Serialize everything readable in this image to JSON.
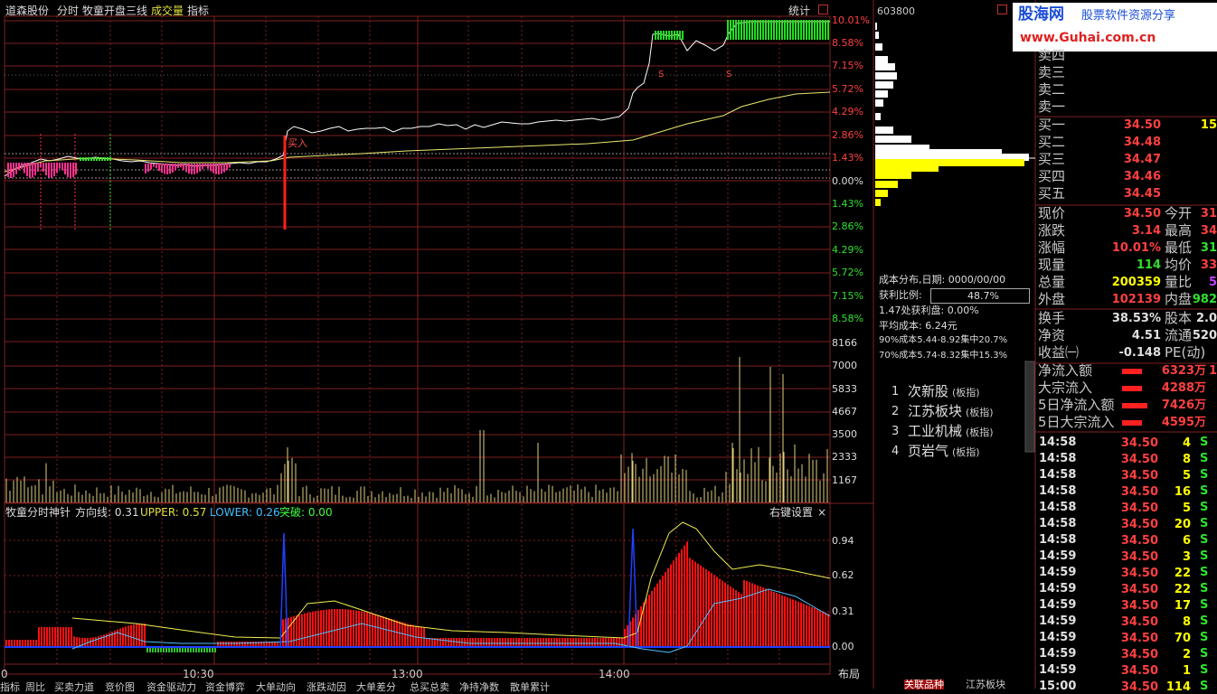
{
  "header": {
    "stock_name": "道森股份",
    "mode": "分时",
    "indicator_name": "牧童开盘三线",
    "volume_label": "成交量",
    "index_label": "指标",
    "stats_label": "统计"
  },
  "price_axis": {
    "right_labels_up": [
      "10.01%",
      "8.58%",
      "7.15%",
      "5.72%",
      "4.29%",
      "2.86%",
      "1.43%",
      "0.00%"
    ],
    "right_labels_down": [
      "1.43%",
      "2.86%",
      "4.29%",
      "5.72%",
      "7.15%",
      "8.58%"
    ],
    "volume_labels": [
      "8166",
      "7000",
      "5833",
      "4667",
      "3500",
      "2333",
      "1167"
    ],
    "indicator_labels": [
      "0.94",
      "0.62",
      "0.31",
      "0.00"
    ]
  },
  "time_axis": [
    "0",
    "10:30",
    "13:00",
    "14:00"
  ],
  "buy_marker": "买入",
  "indicator_bar": {
    "name": "牧童分时神针",
    "dir_label": "方向线: 0.31",
    "upper_label": "UPPER: 0.57",
    "lower_label": "LOWER: 0.26",
    "breakout_label": "突破: 0.00",
    "settings": "右键设置",
    "close": "×"
  },
  "bottom_tabs": [
    "指标",
    "周比",
    "买卖力道",
    "竞价图",
    "资金驱动力",
    "资金博弈",
    "大单动向",
    "涨跌动因",
    "大单差分",
    "总买总卖",
    "净持净数",
    "散单累计"
  ],
  "layout_label": "布局",
  "chip": {
    "code": "603800",
    "date_label": "成本分布,日期: 0000/00/00",
    "profit_label": "获利比例:",
    "profit_value": "48.7%",
    "profit_at": "1.47处获利盘: 0.00%",
    "avg_cost": "平均成本: 6.24元",
    "cost90": "90%成本5.44-8.92集中20.7%",
    "cost70": "70%成本5.74-8.32集中15.3%"
  },
  "sectors": [
    {
      "num": "1",
      "name": "次新股",
      "tag": "(板指)"
    },
    {
      "num": "2",
      "name": "江苏板块",
      "tag": "(板指)"
    },
    {
      "num": "3",
      "name": "工业机械",
      "tag": "(板指)"
    },
    {
      "num": "4",
      "name": "页岩气",
      "tag": "(板指)"
    }
  ],
  "logo": {
    "line1": "股海网",
    "line1b": "股票软件资源分享",
    "line2": "www.Guhai.com.cn"
  },
  "orderbook": {
    "sell": [
      {
        "label": "卖四"
      },
      {
        "label": "卖三"
      },
      {
        "label": "卖二"
      },
      {
        "label": "卖一"
      }
    ],
    "buy": [
      {
        "label": "买一",
        "price": "34.50",
        "vol": "15"
      },
      {
        "label": "买二",
        "price": "34.48",
        "vol": ""
      },
      {
        "label": "买三",
        "price": "34.47",
        "vol": ""
      },
      {
        "label": "买四",
        "price": "34.46",
        "vol": ""
      },
      {
        "label": "买五",
        "price": "34.45",
        "vol": ""
      }
    ]
  },
  "quote": [
    {
      "l1": "现价",
      "v1": "34.50",
      "l2": "今开",
      "v2": "31"
    },
    {
      "l1": "涨跌",
      "v1": "3.14",
      "l2": "最高",
      "v2": "34"
    },
    {
      "l1": "涨幅",
      "v1": "10.01%",
      "l2": "最低",
      "v2": "31"
    },
    {
      "l1": "现量",
      "v1": "114",
      "l2": "均价",
      "v2": "33"
    },
    {
      "l1": "总量",
      "v1": "200359",
      "l2": "量比",
      "v2": "5"
    },
    {
      "l1": "外盘",
      "v1": "102139",
      "l2": "内盘",
      "v2": "982"
    }
  ],
  "fundamentals": [
    {
      "l1": "换手",
      "v1": "38.53%",
      "l2": "股本",
      "v2": "2.0"
    },
    {
      "l1": "净资",
      "v1": "4.51",
      "l2": "流通",
      "v2": "520"
    },
    {
      "l1": "收益㈠",
      "v1": "-0.148",
      "l2": "PE(动)",
      "v2": ""
    }
  ],
  "flows": [
    {
      "label": "净流入额",
      "value": "6323万",
      "extra": "1"
    },
    {
      "label": "大宗流入",
      "value": "4288万",
      "extra": ""
    },
    {
      "label": "5日净流入额",
      "value": "7426万",
      "extra": ""
    },
    {
      "label": "5日大宗流入",
      "value": "4595万",
      "extra": ""
    }
  ],
  "ticks": [
    {
      "time": "14:58",
      "price": "34.50",
      "vol": "4",
      "side": "S"
    },
    {
      "time": "14:58",
      "price": "34.50",
      "vol": "8",
      "side": "S"
    },
    {
      "time": "14:58",
      "price": "34.50",
      "vol": "5",
      "side": "S"
    },
    {
      "time": "14:58",
      "price": "34.50",
      "vol": "16",
      "side": "S"
    },
    {
      "time": "14:58",
      "price": "34.50",
      "vol": "5",
      "side": "S"
    },
    {
      "time": "14:58",
      "price": "34.50",
      "vol": "20",
      "side": "S"
    },
    {
      "time": "14:58",
      "price": "34.50",
      "vol": "6",
      "side": "S"
    },
    {
      "time": "14:59",
      "price": "34.50",
      "vol": "3",
      "side": "S"
    },
    {
      "time": "14:59",
      "price": "34.50",
      "vol": "22",
      "side": "S"
    },
    {
      "time": "14:59",
      "price": "34.50",
      "vol": "22",
      "side": "S"
    },
    {
      "time": "14:59",
      "price": "34.50",
      "vol": "17",
      "side": "S"
    },
    {
      "time": "14:59",
      "price": "34.50",
      "vol": "8",
      "side": "S"
    },
    {
      "time": "14:59",
      "price": "34.50",
      "vol": "70",
      "side": "S"
    },
    {
      "time": "14:59",
      "price": "34.50",
      "vol": "2",
      "side": "S"
    },
    {
      "time": "14:59",
      "price": "34.50",
      "vol": "1",
      "side": "S"
    },
    {
      "time": "15:00",
      "price": "34.50",
      "vol": "114",
      "side": "S"
    }
  ],
  "footer_tabs": [
    "关联品种",
    "江苏板块"
  ]
}
